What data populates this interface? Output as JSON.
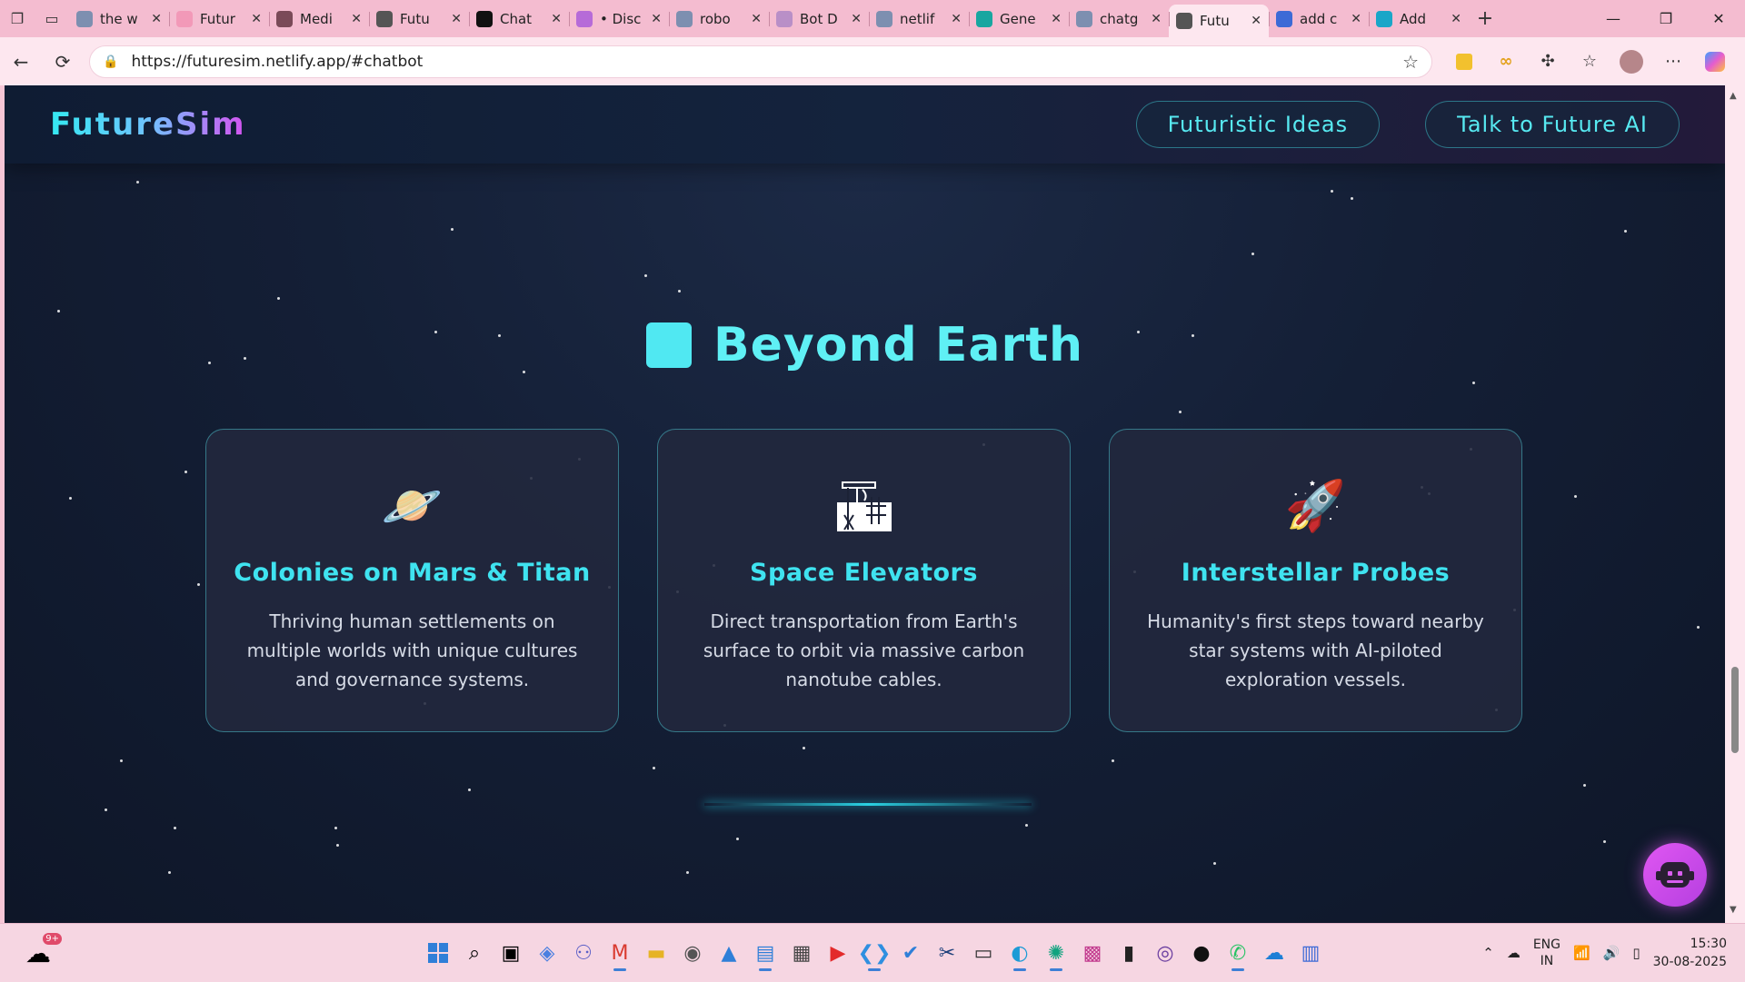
{
  "browser": {
    "tabs": [
      {
        "title": "the w",
        "favicon": "search-icon",
        "color": "#7d8fb0"
      },
      {
        "title": "Futur",
        "favicon": "pink-dot-icon",
        "color": "#f299b8"
      },
      {
        "title": "Medi",
        "favicon": "medium-icon",
        "color": "#7a4a58"
      },
      {
        "title": "Futu",
        "favicon": "globe-icon",
        "color": "#555555"
      },
      {
        "title": "Chat",
        "favicon": "chat-c-icon",
        "color": "#111111"
      },
      {
        "title": "• Disc",
        "favicon": "discord-icon",
        "color": "#b66bd8"
      },
      {
        "title": "robo",
        "favicon": "search-icon",
        "color": "#7d8fb0"
      },
      {
        "title": "Bot D",
        "favicon": "grid-icon",
        "color": "#b98fc7"
      },
      {
        "title": "netlif",
        "favicon": "search-icon",
        "color": "#7d8fb0"
      },
      {
        "title": "Gene",
        "favicon": "diamond-icon",
        "color": "#18a6a0"
      },
      {
        "title": "chatg",
        "favicon": "search-icon",
        "color": "#7d8fb0"
      },
      {
        "title": "Futu",
        "favicon": "globe-icon",
        "color": "#555555",
        "active": true
      },
      {
        "title": "add c",
        "favicon": "search-icon",
        "color": "#3d6ad6"
      },
      {
        "title": "Add",
        "favicon": "play-icon",
        "color": "#1aa6c8"
      }
    ],
    "url": "https://futuresim.netlify.app/#chatbot"
  },
  "site": {
    "logo": "FutureSim",
    "nav": {
      "ideas_label": "Futuristic Ideas",
      "ai_label": "Talk to Future AI"
    },
    "section_title": "Beyond Earth",
    "cards": [
      {
        "icon": "🪐",
        "title": "Colonies on Mars & Titan",
        "description": "Thriving human settlements on multiple worlds with unique cultures and governance systems."
      },
      {
        "icon": "🏗",
        "title": "Space Elevators",
        "description": "Direct transportation from Earth's surface to orbit via massive carbon nanotube cables."
      },
      {
        "icon": "🚀",
        "title": "Interstellar Probes",
        "description": "Humanity's first steps toward nearby star systems with AI-piloted exploration vessels."
      }
    ]
  },
  "taskbar": {
    "weather_badge": "9+",
    "language": "ENG",
    "region": "IN",
    "time": "15:30",
    "date": "30-08-2025"
  }
}
